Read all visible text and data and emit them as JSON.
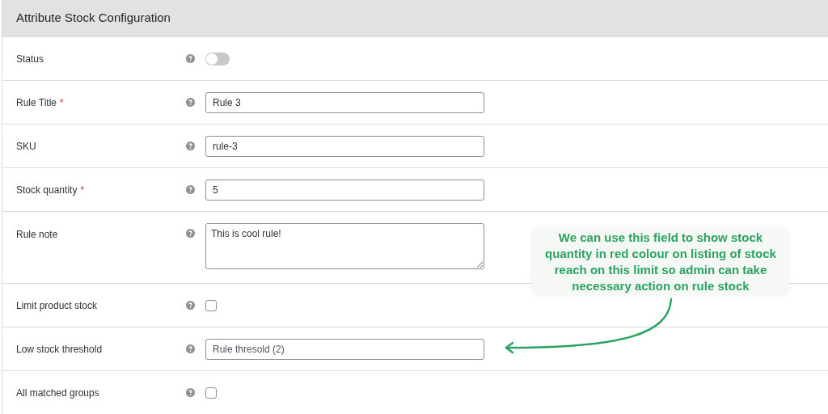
{
  "panel": {
    "title": "Attribute Stock Configuration"
  },
  "rows": [
    {
      "label": "Status",
      "kind": "toggle",
      "on": false
    },
    {
      "label": "Rule Title",
      "required_mark": "*",
      "kind": "text",
      "value": "Rule 3"
    },
    {
      "label": "SKU",
      "kind": "text",
      "value": "rule-3"
    },
    {
      "label": "Stock quantity",
      "required_mark": "*",
      "kind": "text",
      "value": "5"
    },
    {
      "label": "Rule note",
      "kind": "textarea",
      "value": "This is cool rule!"
    },
    {
      "label": "Limit product stock",
      "kind": "checkbox",
      "checked": false
    },
    {
      "label": "Low stock threshold",
      "kind": "text",
      "placeholder": "Rule thresold (2)"
    },
    {
      "label": "All matched groups",
      "kind": "checkbox",
      "checked": false
    }
  ],
  "annotation": {
    "text": "We can use this field to show stock quantity in red colour on listing of stock reach on this limit so admin can take necessary action on rule stock"
  }
}
